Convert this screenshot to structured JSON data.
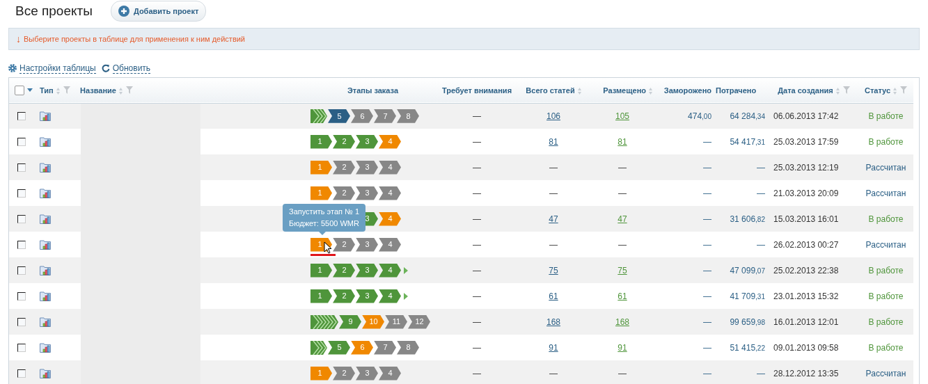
{
  "page": {
    "title": "Все проекты",
    "add_button": "Добавить проект"
  },
  "notice": {
    "arrow": "↓",
    "text": "Выберите проекты в таблице для применения к ним действий"
  },
  "toolbar": [
    {
      "kind": "settings",
      "label": "Настройки таблицы"
    },
    {
      "kind": "refresh",
      "label": "Обновить"
    }
  ],
  "table": {
    "select_all": {
      "checked": false
    },
    "columns": [
      {
        "label": "Тип",
        "sortable": true,
        "filterable": true
      },
      {
        "label": "Название",
        "sortable": true,
        "filterable": true
      },
      {
        "label": "Этапы заказа",
        "sortable": false,
        "filterable": false
      },
      {
        "label": "Требует внимания",
        "sortable": false,
        "filterable": false
      },
      {
        "label": "Всего статей",
        "sortable": true,
        "filterable": false
      },
      {
        "label": "Размещено",
        "sortable": true,
        "filterable": false
      },
      {
        "label": "Заморожено",
        "sortable": false,
        "filterable": false
      },
      {
        "label": "Потрачено",
        "sortable": false,
        "filterable": false
      },
      {
        "label": "Дата создания",
        "sortable": true,
        "filterable": true
      },
      {
        "label": "Статус",
        "sortable": true,
        "filterable": true
      }
    ],
    "rows": [
      {
        "checked": false,
        "stages": [
          {
            "kind": "folded"
          },
          {
            "kind": "current",
            "label": "5"
          },
          {
            "kind": "pending",
            "label": "6"
          },
          {
            "kind": "pending",
            "label": "7"
          },
          {
            "kind": "pending",
            "label": "8"
          }
        ],
        "next": false,
        "attention": "—",
        "total": "106",
        "placed": "105",
        "frozen": {
          "int": "474",
          "frac": ",00"
        },
        "spent": {
          "int": "64 284",
          "frac": ",34"
        },
        "date": "06.06.2013 17:42",
        "status": {
          "kind": "working",
          "label": "В работе"
        }
      },
      {
        "checked": false,
        "stages": [
          {
            "kind": "done",
            "label": "1"
          },
          {
            "kind": "done",
            "label": "2"
          },
          {
            "kind": "done",
            "label": "3"
          },
          {
            "kind": "active",
            "label": "4"
          }
        ],
        "next": false,
        "attention": "—",
        "total": "81",
        "placed": "81",
        "frozen": {
          "int": "—"
        },
        "spent": {
          "int": "54 417",
          "frac": ",31"
        },
        "date": "25.03.2013 17:59",
        "status": {
          "kind": "working",
          "label": "В работе"
        }
      },
      {
        "checked": false,
        "stages": [
          {
            "kind": "active",
            "label": "1"
          },
          {
            "kind": "pending",
            "label": "2"
          },
          {
            "kind": "pending",
            "label": "3"
          },
          {
            "kind": "pending",
            "label": "4"
          }
        ],
        "next": false,
        "attention": "—",
        "total": "—",
        "placed": "—",
        "frozen": {
          "int": "—"
        },
        "spent": {
          "int": "—"
        },
        "date": "25.03.2013 12:19",
        "status": {
          "kind": "calculated",
          "label": "Рассчитан"
        }
      },
      {
        "checked": false,
        "stages": [
          {
            "kind": "active",
            "label": "1"
          },
          {
            "kind": "pending",
            "label": "2"
          },
          {
            "kind": "pending",
            "label": "3"
          },
          {
            "kind": "pending",
            "label": "4"
          }
        ],
        "next": false,
        "attention": "—",
        "total": "—",
        "placed": "—",
        "frozen": {
          "int": "—"
        },
        "spent": {
          "int": "—"
        },
        "date": "21.03.2013 20:09",
        "status": {
          "kind": "calculated",
          "label": "Рассчитан"
        }
      },
      {
        "checked": false,
        "stages": [
          {
            "kind": "covered"
          },
          {
            "kind": "covered"
          },
          {
            "kind": "done",
            "label": "3"
          },
          {
            "kind": "active",
            "label": "4"
          }
        ],
        "next": false,
        "attention": "—",
        "total": "47",
        "placed": "47",
        "frozen": {
          "int": "—"
        },
        "spent": {
          "int": "31 606",
          "frac": ",82"
        },
        "date": "15.03.2013 16:01",
        "status": {
          "kind": "working",
          "label": "В работе"
        }
      },
      {
        "checked": false,
        "hovered": true,
        "tooltip": [
          "Запустить этап № 1",
          "Бюджет: 5500 WMR"
        ],
        "stages": [
          {
            "kind": "active",
            "label": "1"
          },
          {
            "kind": "pending",
            "label": "2"
          },
          {
            "kind": "pending",
            "label": "3"
          },
          {
            "kind": "pending",
            "label": "4"
          }
        ],
        "next": false,
        "attention": "—",
        "total": "—",
        "placed": "—",
        "frozen": {
          "int": "—"
        },
        "spent": {
          "int": "—"
        },
        "date": "26.02.2013 00:27",
        "status": {
          "kind": "calculated",
          "label": "Рассчитан"
        }
      },
      {
        "checked": false,
        "stages": [
          {
            "kind": "done",
            "label": "1"
          },
          {
            "kind": "done",
            "label": "2"
          },
          {
            "kind": "done",
            "label": "3"
          },
          {
            "kind": "done",
            "label": "4"
          }
        ],
        "next": true,
        "attention": "—",
        "total": "75",
        "placed": "75",
        "frozen": {
          "int": "—"
        },
        "spent": {
          "int": "47 099",
          "frac": ",07"
        },
        "date": "25.02.2013 22:38",
        "status": {
          "kind": "working",
          "label": "В работе"
        }
      },
      {
        "checked": false,
        "stages": [
          {
            "kind": "done",
            "label": "1"
          },
          {
            "kind": "done",
            "label": "2"
          },
          {
            "kind": "done",
            "label": "3"
          },
          {
            "kind": "done",
            "label": "4"
          }
        ],
        "next": true,
        "attention": "—",
        "total": "61",
        "placed": "61",
        "frozen": {
          "int": "—"
        },
        "spent": {
          "int": "41 709",
          "frac": ",31"
        },
        "date": "23.01.2013 15:32",
        "status": {
          "kind": "working",
          "label": "В работе"
        }
      },
      {
        "checked": false,
        "stages": [
          {
            "kind": "longfolded"
          },
          {
            "kind": "done",
            "label": "9"
          },
          {
            "kind": "active",
            "label": "10"
          },
          {
            "kind": "pending",
            "label": "11"
          },
          {
            "kind": "pending",
            "label": "12"
          }
        ],
        "next": false,
        "attention": "—",
        "total": "168",
        "placed": "168",
        "frozen": {
          "int": "—"
        },
        "spent": {
          "int": "99 659",
          "frac": ",98"
        },
        "date": "16.01.2013 12:01",
        "status": {
          "kind": "working",
          "label": "В работе"
        }
      },
      {
        "checked": false,
        "stages": [
          {
            "kind": "folded"
          },
          {
            "kind": "done",
            "label": "5"
          },
          {
            "kind": "active",
            "label": "6"
          },
          {
            "kind": "pending",
            "label": "7"
          },
          {
            "kind": "pending",
            "label": "8"
          }
        ],
        "next": false,
        "attention": "—",
        "total": "91",
        "placed": "91",
        "frozen": {
          "int": "—"
        },
        "spent": {
          "int": "51 415",
          "frac": ",22"
        },
        "date": "09.01.2013 09:58",
        "status": {
          "kind": "working",
          "label": "В работе"
        }
      },
      {
        "checked": false,
        "stages": [
          {
            "kind": "active",
            "label": "1"
          },
          {
            "kind": "pending",
            "label": "2"
          },
          {
            "kind": "pending",
            "label": "3"
          },
          {
            "kind": "pending",
            "label": "4"
          }
        ],
        "next": false,
        "attention": "—",
        "total": "—",
        "placed": "—",
        "frozen": {
          "int": "—"
        },
        "spent": {
          "int": "—"
        },
        "date": "28.12.2012 13:35",
        "status": {
          "kind": "calculated",
          "label": "Рассчитан"
        }
      }
    ]
  }
}
